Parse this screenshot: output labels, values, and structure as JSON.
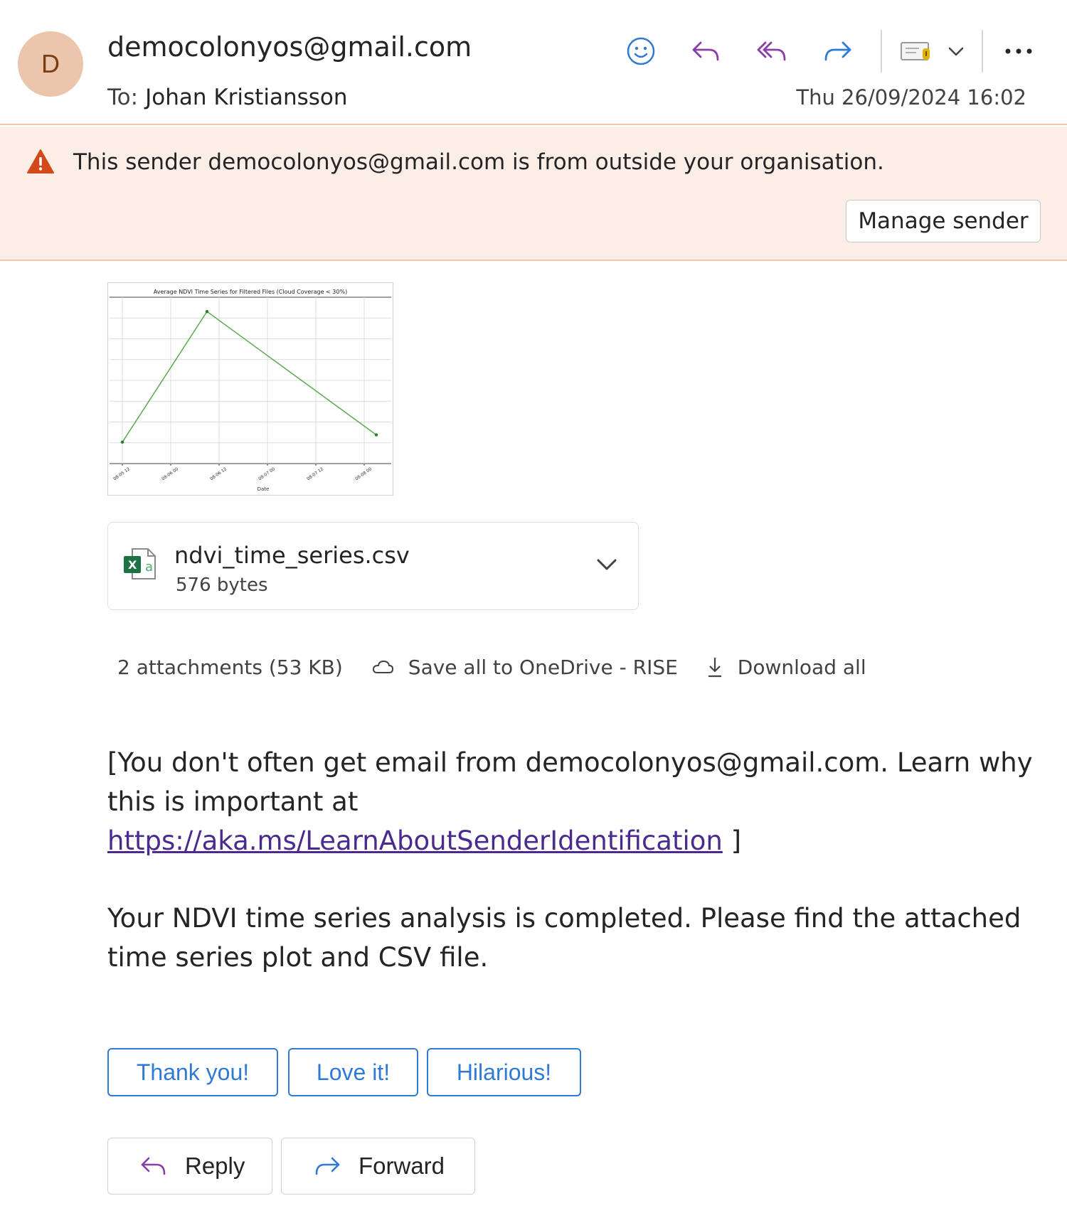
{
  "header": {
    "avatar_initial": "D",
    "sender": "democolonyos@gmail.com",
    "to_label": "To:",
    "to_name": "Johan Kristiansson",
    "date": "Thu 26/09/2024 16:02"
  },
  "toolbar": {
    "icons": [
      "smiley-icon",
      "reply-icon",
      "reply-all-icon",
      "forward-icon",
      "mark-icon",
      "chevron-down-icon",
      "more-icon"
    ]
  },
  "warning": {
    "text": "This sender democolonyos@gmail.com is from outside your organisation.",
    "manage_label": "Manage sender"
  },
  "chart_thumbnail": {
    "chart_data": {
      "type": "line",
      "title": "Average NDVI Time Series for Filtered Files (Cloud Coverage < 30%)",
      "xlabel": "Date",
      "ylabel": "",
      "x_tick_labels": [
        "08-05 12",
        "08-06 00",
        "08-06 12",
        "08-07 00",
        "08-07 12",
        "08-08 00"
      ],
      "series": [
        {
          "x": [
            "08-05 12",
            "08-06 09",
            "08-08 03"
          ],
          "values": [
            0.05,
            0.95,
            0.1
          ]
        }
      ],
      "grid": true,
      "color": "#5aab4c"
    }
  },
  "attachment": {
    "filename": "ndvi_time_series.csv",
    "size": "576 bytes"
  },
  "attachments_summary": {
    "count_label": "2 attachments (53 KB)",
    "save_label": "Save all to OneDrive - RISE",
    "download_label": "Download all"
  },
  "body": {
    "p1_prefix": "[You don't often get email from democolonyos@gmail.com. Learn why this is important at",
    "p1_link": "https://aka.ms/LearnAboutSenderIdentification",
    "p1_suffix": " ]",
    "p2": "Your NDVI time series analysis is completed. Please find the attached time series plot and CSV file."
  },
  "quick_replies": [
    "Thank you!",
    "Love it!",
    "Hilarious!"
  ],
  "actions": {
    "reply_label": "Reply",
    "forward_label": "Forward"
  },
  "colors": {
    "accent_blue": "#2f7ad5",
    "reply_purple": "#8a3fa6",
    "warning_bg": "#fbeee6",
    "warning_icon": "#d24a1b",
    "avatar_bg": "#ecc6ac"
  }
}
